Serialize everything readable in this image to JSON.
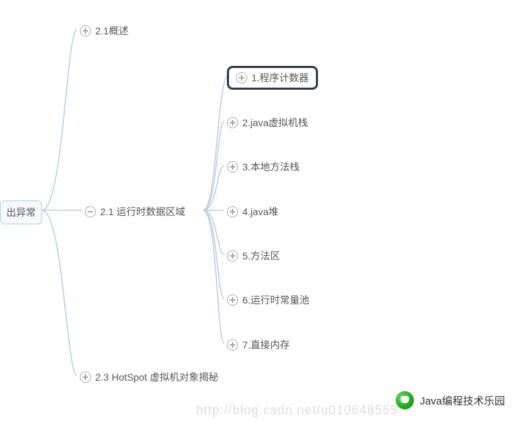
{
  "root": {
    "label": "出异常"
  },
  "level1": {
    "n0": {
      "label": "2.1概述",
      "toggle": "plus"
    },
    "n1": {
      "label": "2.1 运行时数据区域",
      "toggle": "minus"
    },
    "n2": {
      "label": "2.3 HotSpot 虚拟机对象揭秘",
      "toggle": "plus"
    }
  },
  "level2": {
    "c0": {
      "label": "1.程序计数器",
      "toggle": "plus",
      "selected": true
    },
    "c1": {
      "label": "2.java虚拟机栈",
      "toggle": "plus"
    },
    "c2": {
      "label": "3.本地方法栈",
      "toggle": "plus"
    },
    "c3": {
      "label": "4.java堆",
      "toggle": "plus"
    },
    "c4": {
      "label": "5.方法区",
      "toggle": "plus"
    },
    "c5": {
      "label": "6.运行时常量池",
      "toggle": "plus"
    },
    "c6": {
      "label": "7.直接内存",
      "toggle": "plus"
    }
  },
  "watermark": "http://blog.csdn.net/u010648555",
  "brand": "Java编程技术乐园",
  "colors": {
    "connector": "#b6cde5",
    "selected_border": "#2a3d4d"
  }
}
